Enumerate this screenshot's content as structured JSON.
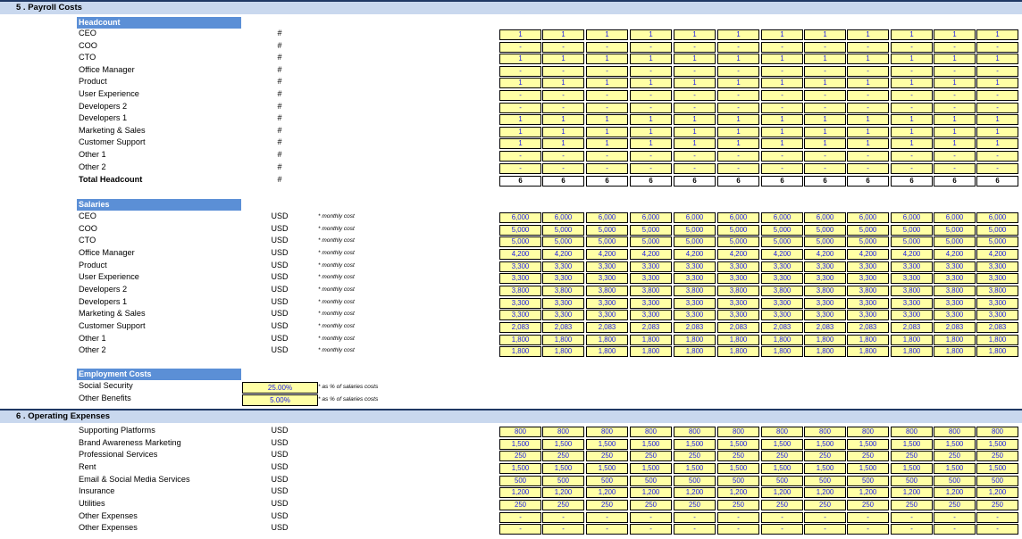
{
  "sections": {
    "payroll": "5 . Payroll Costs",
    "operating": "6 . Operating Expenses"
  },
  "headcount": {
    "title": "Headcount",
    "unit": "#",
    "rows": [
      {
        "label": "CEO",
        "value": "1"
      },
      {
        "label": "COO",
        "value": "-"
      },
      {
        "label": "CTO",
        "value": "1"
      },
      {
        "label": "Office Manager",
        "value": "-"
      },
      {
        "label": "Product",
        "value": "1"
      },
      {
        "label": "User Experience",
        "value": "-"
      },
      {
        "label": "Developers 2",
        "value": "-"
      },
      {
        "label": "Developers 1",
        "value": "1"
      },
      {
        "label": "Marketing & Sales",
        "value": "1"
      },
      {
        "label": "Customer Support",
        "value": "1"
      },
      {
        "label": "Other 1",
        "value": "-"
      },
      {
        "label": "Other 2",
        "value": "-"
      }
    ],
    "total": {
      "label": "Total Headcount",
      "value": "6"
    }
  },
  "salaries": {
    "title": "Salaries",
    "unit": "USD",
    "note": "* monthly cost",
    "rows": [
      {
        "label": "CEO",
        "value": "6,000"
      },
      {
        "label": "COO",
        "value": "5,000"
      },
      {
        "label": "CTO",
        "value": "5,000"
      },
      {
        "label": "Office Manager",
        "value": "4,200"
      },
      {
        "label": "Product",
        "value": "3,300"
      },
      {
        "label": "User Experience",
        "value": "3,300"
      },
      {
        "label": "Developers 2",
        "value": "3,800"
      },
      {
        "label": "Developers 1",
        "value": "3,300"
      },
      {
        "label": "Marketing & Sales",
        "value": "3,300"
      },
      {
        "label": "Customer Support",
        "value": "2,083"
      },
      {
        "label": "Other 1",
        "value": "1,800"
      },
      {
        "label": "Other 2",
        "value": "1,800"
      }
    ]
  },
  "employment": {
    "title": "Employment Costs",
    "note": "* as % of salaries costs",
    "rows": [
      {
        "label": "Social Security",
        "value": "25.00%"
      },
      {
        "label": "Other Benefits",
        "value": "5.00%"
      }
    ]
  },
  "opex": {
    "unit": "USD",
    "rows": [
      {
        "label": "Supporting Platforms",
        "value": "800"
      },
      {
        "label": "Brand Awareness Marketing",
        "value": "1,500"
      },
      {
        "label": "Professional Services",
        "value": "250"
      },
      {
        "label": "Rent",
        "value": "1,500"
      },
      {
        "label": "Email & Social Media Services",
        "value": "500"
      },
      {
        "label": "Insurance",
        "value": "1,200"
      },
      {
        "label": "Utilities",
        "value": "250"
      },
      {
        "label": "Other Expenses",
        "value": "-"
      },
      {
        "label": "Other Expenses",
        "value": "-"
      }
    ]
  }
}
